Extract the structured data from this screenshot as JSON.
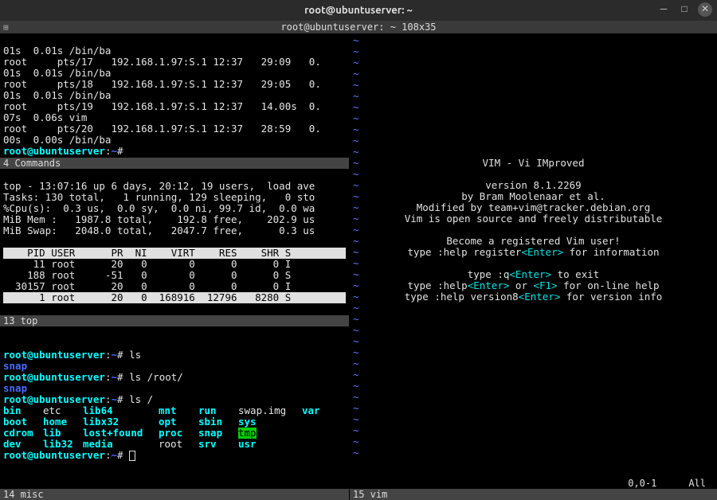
{
  "window": {
    "title": "root@ubuntuserver: ~",
    "subtitle": "root@ubuntuserver: ~ 108x35"
  },
  "pane1": {
    "lines": [
      "01s  0.01s /bin/ba",
      "root     pts/17   192.168.1.97:S.1 12:37   29:09   0.",
      "01s  0.01s /bin/ba",
      "root     pts/18   192.168.1.97:S.1 12:37   29:05   0.",
      "01s  0.01s /bin/ba",
      "root     pts/19   192.168.1.97:S.1 12:37   14.00s  0.",
      "07s  0.06s vim",
      "root     pts/20   192.168.1.97:S.1 12:37   28:59   0.",
      "00s  0.00s /bin/ba"
    ],
    "prompt_user": "root@ubuntuserver",
    "prompt_path": "~",
    "status": "4 Commands"
  },
  "pane2": {
    "top_line": "top - 13:07:16 up 6 days, 20:12, 19 users,  load ave",
    "tasks": "Tasks: 130 total,   1 running, 129 sleeping,   0 sto",
    "cpu": "%Cpu(s):  0.3 us,  0.0 sy,  0.0 ni, 99.7 id,  0.0 wa",
    "mem": "MiB Mem :   1987.8 total,    192.8 free,    202.9 us",
    "swap": "MiB Swap:   2048.0 total,   2047.7 free,      0.3 us",
    "header": "    PID USER      PR  NI    VIRT    RES    SHR S",
    "rows": [
      "     11 root      20   0       0      0      0 I",
      "    188 root     -51   0       0      0      0 S",
      "  30157 root      20   0       0      0      0 I",
      "      1 root      20   0  168916  12796   8280 S"
    ],
    "status": "13 top"
  },
  "pane3": {
    "prompt_user": "root@ubuntuserver",
    "prompt_path": "~",
    "cmds": [
      "ls",
      "ls /root/",
      "ls /"
    ],
    "snap": "snap",
    "ls_root": {
      "col1": [
        "bin",
        "boot",
        "cdrom",
        "dev"
      ],
      "col2": [
        "etc",
        "home",
        "lib",
        "lib32"
      ],
      "col3": [
        "lib64",
        "libx32",
        "lost+found",
        "media"
      ],
      "col4": [
        "mnt",
        "opt",
        "proc",
        "root"
      ],
      "col5": [
        "run",
        "sbin",
        "snap",
        "srv"
      ],
      "col6_0": "swap.img",
      "col6_1": "sys",
      "col6_2": "tmp",
      "col6_3": "usr",
      "col7_0": "var"
    },
    "status": "14 misc"
  },
  "vim": {
    "title": "VIM - Vi IMproved",
    "version": "version 8.1.2269",
    "by": "by Bram Moolenaar et al.",
    "modified": "Modified by team+vim@tracker.debian.org",
    "open": "Vim is open source and freely distributable",
    "become": "Become a registered Vim user!",
    "help_reg_a": "type  :help register",
    "help_reg_b": "   for information",
    "quit_a": "type  :q",
    "quit_b": "               to exit",
    "help_a": "type  :help",
    "help_b": "  or  ",
    "help_c": "      for on-line help",
    "ver_a": "type  :help version8",
    "ver_b": "   for version info",
    "enter": "<Enter>",
    "f1": "<F1>",
    "pos": "0,0-1",
    "all": "All",
    "status": "15 vim"
  }
}
